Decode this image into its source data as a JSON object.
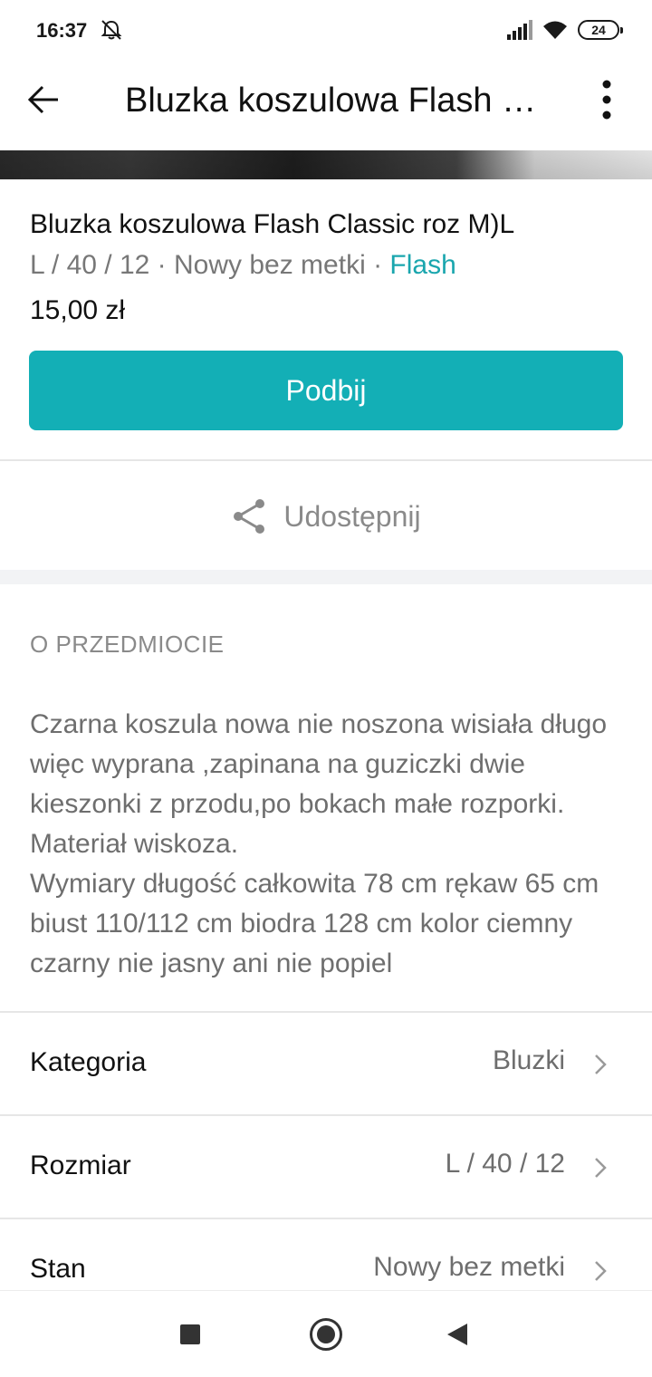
{
  "status_bar": {
    "time": "16:37",
    "icons": [
      "alarm-off-icon",
      "signal-icon",
      "wifi-icon",
      "battery-icon"
    ],
    "battery": "24"
  },
  "header": {
    "title": "Bluzka koszulowa Flash Classic roz M)L",
    "back_icon": "arrow-left-icon",
    "more_icon": "more-vertical-icon"
  },
  "item": {
    "title": "Bluzka koszulowa Flash Classic roz M)L",
    "size": "L / 40 / 12",
    "separator": " · ",
    "condition": "Nowy bez metki",
    "brand": "Flash",
    "price": "15,00 zł",
    "bump_label": "Podbij"
  },
  "share": {
    "label": "Udostępnij",
    "icon": "share-icon"
  },
  "about": {
    "heading": "O PRZEDMIOCIE",
    "description": "Czarna koszula nowa nie noszona wisiała długo więc wyprana ,zapinana na guziczki dwie kieszonki z przodu,po bokach małe rozporki. Materiał wiskoza.\nWymiary długość całkowita 78 cm rękaw 65 cm biust 110/112 cm biodra 128 cm kolor ciemny czarny nie jasny ani nie popiel"
  },
  "attributes": [
    {
      "label": "Kategoria",
      "value": "Bluzki"
    },
    {
      "label": "Rozmiar",
      "value": "L / 40 / 12"
    },
    {
      "label": "Stan",
      "value": "Nowy bez metki"
    }
  ],
  "colors": {
    "accent": "#13afb6",
    "brand_link": "#1aa6ae",
    "muted_text": "#6e6e6e"
  },
  "nav_bar": {
    "icons": [
      "recent-apps-icon",
      "home-icon",
      "back-triangle-icon"
    ]
  }
}
